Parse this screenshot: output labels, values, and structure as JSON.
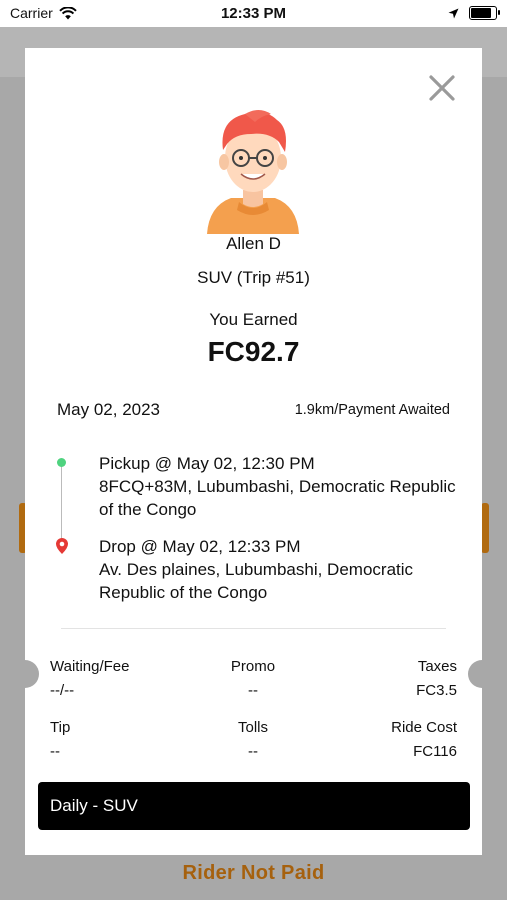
{
  "status_bar": {
    "carrier": "Carrier",
    "time": "12:33 PM"
  },
  "driver": {
    "name": "Allen D",
    "vehicle_trip": "SUV (Trip #51)"
  },
  "earnings": {
    "label": "You Earned",
    "amount": "FC92.7"
  },
  "trip": {
    "date": "May 02, 2023",
    "distance_status": "1.9km/Payment Awaited",
    "pickup_title": "Pickup @ May 02, 12:30 PM",
    "pickup_address": "8FCQ+83M, Lubumbashi, Democratic Republic of the Congo",
    "drop_title": "Drop @ May 02, 12:33 PM",
    "drop_address": "Av. Des plaines, Lubumbashi, Democratic Republic of the Congo"
  },
  "fees": {
    "waiting_label": "Waiting/Fee",
    "waiting_value": "--/--",
    "promo_label": "Promo",
    "promo_value": "--",
    "taxes_label": "Taxes",
    "taxes_value": "FC3.5",
    "tip_label": "Tip",
    "tip_value": "--",
    "tolls_label": "Tolls",
    "tolls_value": "--",
    "ride_cost_label": "Ride Cost",
    "ride_cost_value": "FC116"
  },
  "plan": {
    "label": "Daily - SUV"
  },
  "footer": {
    "status": "Rider Not Paid"
  },
  "colors": {
    "accent": "#a6610e",
    "pickup_dot": "#4fd37f",
    "drop_pin": "#e53935"
  },
  "icons": {
    "close": "close-icon",
    "pickup": "pickup-dot-icon",
    "drop": "drop-pin-icon",
    "wifi": "wifi-icon",
    "location": "location-arrow-icon",
    "battery": "battery-icon"
  }
}
